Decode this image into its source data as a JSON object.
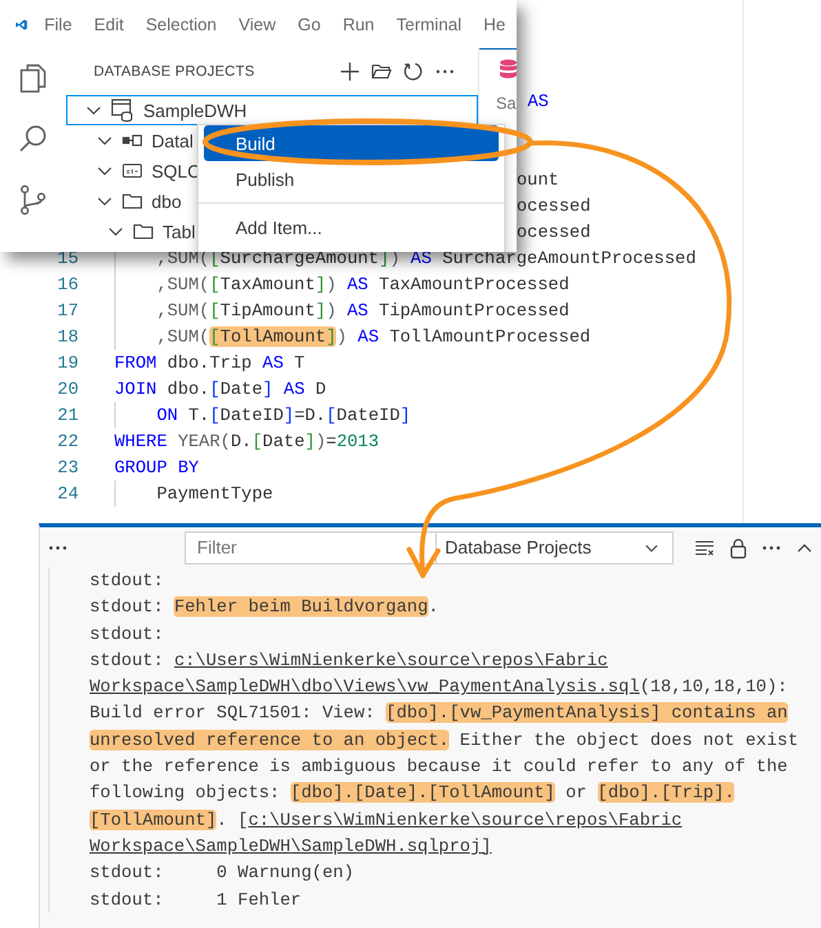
{
  "popup": {
    "menubar": [
      "File",
      "Edit",
      "Selection",
      "View",
      "Go",
      "Run",
      "Terminal",
      "He"
    ],
    "sidebar": {
      "title": "DATABASE PROJECTS",
      "tree": [
        {
          "label": "SampleDWH",
          "kind": "project",
          "expanded": true,
          "focused": true,
          "children": [
            {
              "label": "Datal",
              "kind": "datasource",
              "expanded": true,
              "focused": false
            },
            {
              "label": "SQLC",
              "kind": "variables",
              "expanded": true,
              "focused": false
            },
            {
              "label": "dbo",
              "kind": "folder",
              "expanded": true,
              "focused": false,
              "children": [
                {
                  "label": "Tabl",
                  "kind": "folder",
                  "expanded": true,
                  "focused": false
                }
              ]
            }
          ]
        }
      ]
    },
    "editor_peek": {
      "breadcrumb": "Sa"
    },
    "context_menu": [
      {
        "label": "Build",
        "selected": true,
        "separated": false
      },
      {
        "label": "Publish",
        "selected": false,
        "separated": false
      },
      {
        "label": "Add Item...",
        "selected": false,
        "separated": true
      }
    ]
  },
  "editor": {
    "fragments": [
      {
        "tokens": [
          {
            "text": "AS",
            "kind": "keyword"
          }
        ]
      },
      {
        "tokens": [
          {
            "text": "ount",
            "kind": "plain"
          }
        ]
      },
      {
        "tokens": [
          {
            "text": "ocessed",
            "kind": "plain"
          }
        ]
      },
      {
        "tokens": [
          {
            "text": "ocessed",
            "kind": "plain"
          }
        ]
      }
    ],
    "lines": [
      {
        "number": "15",
        "indented": true,
        "tokens": [
          {
            "text": ",SUM(",
            "kind": "func"
          },
          {
            "text": "[",
            "kind": "bracket2"
          },
          {
            "text": "SurchargeAmount",
            "kind": "plain"
          },
          {
            "text": "]",
            "kind": "bracket2"
          },
          {
            "text": ")",
            "kind": "func"
          },
          {
            "text": " AS ",
            "kind": "keyword"
          },
          {
            "text": "SurchargeAmountProcessed",
            "kind": "plain"
          }
        ]
      },
      {
        "number": "16",
        "indented": true,
        "tokens": [
          {
            "text": ",SUM(",
            "kind": "func"
          },
          {
            "text": "[",
            "kind": "bracket2"
          },
          {
            "text": "TaxAmount",
            "kind": "plain"
          },
          {
            "text": "]",
            "kind": "bracket2"
          },
          {
            "text": ")",
            "kind": "func"
          },
          {
            "text": " AS ",
            "kind": "keyword"
          },
          {
            "text": "TaxAmountProcessed",
            "kind": "plain"
          }
        ]
      },
      {
        "number": "17",
        "indented": true,
        "tokens": [
          {
            "text": ",SUM(",
            "kind": "func"
          },
          {
            "text": "[",
            "kind": "bracket2"
          },
          {
            "text": "TipAmount",
            "kind": "plain"
          },
          {
            "text": "]",
            "kind": "bracket2"
          },
          {
            "text": ")",
            "kind": "func"
          },
          {
            "text": " AS ",
            "kind": "keyword"
          },
          {
            "text": "TipAmountProcessed",
            "kind": "plain"
          }
        ]
      },
      {
        "number": "18",
        "indented": true,
        "tokens": [
          {
            "text": ",SUM(",
            "kind": "func"
          },
          {
            "kind": "highlight",
            "tokens": [
              {
                "text": "[",
                "kind": "bracket2"
              },
              {
                "text": "TollAmount",
                "kind": "plain"
              },
              {
                "text": "]",
                "kind": "bracket2"
              }
            ]
          },
          {
            "text": ")",
            "kind": "func"
          },
          {
            "text": " AS ",
            "kind": "keyword"
          },
          {
            "text": "TollAmountProcessed",
            "kind": "plain"
          }
        ]
      },
      {
        "number": "19",
        "indented": false,
        "tokens": [
          {
            "text": "FROM",
            "kind": "keyword"
          },
          {
            "text": " dbo.Trip ",
            "kind": "plain"
          },
          {
            "text": "AS",
            "kind": "keyword"
          },
          {
            "text": " T",
            "kind": "plain"
          }
        ]
      },
      {
        "number": "20",
        "indented": false,
        "tokens": [
          {
            "text": "JOIN",
            "kind": "keyword"
          },
          {
            "text": " dbo.",
            "kind": "plain"
          },
          {
            "text": "[",
            "kind": "bracket1"
          },
          {
            "text": "Date",
            "kind": "plain"
          },
          {
            "text": "]",
            "kind": "bracket1"
          },
          {
            "text": " AS ",
            "kind": "keyword"
          },
          {
            "text": "D",
            "kind": "plain"
          }
        ]
      },
      {
        "number": "21",
        "indented": true,
        "tokens": [
          {
            "text": "ON",
            "kind": "keyword"
          },
          {
            "text": " T.",
            "kind": "plain"
          },
          {
            "text": "[",
            "kind": "bracket1"
          },
          {
            "text": "DateID",
            "kind": "plain"
          },
          {
            "text": "]",
            "kind": "bracket1"
          },
          {
            "text": "=D.",
            "kind": "plain"
          },
          {
            "text": "[",
            "kind": "bracket1"
          },
          {
            "text": "DateID",
            "kind": "plain"
          },
          {
            "text": "]",
            "kind": "bracket1"
          }
        ]
      },
      {
        "number": "22",
        "indented": false,
        "tokens": [
          {
            "text": "WHERE ",
            "kind": "keyword"
          },
          {
            "text": "YEAR(",
            "kind": "func"
          },
          {
            "text": "D.",
            "kind": "plain"
          },
          {
            "text": "[",
            "kind": "bracket2"
          },
          {
            "text": "Date",
            "kind": "plain"
          },
          {
            "text": "]",
            "kind": "bracket2"
          },
          {
            "text": ")",
            "kind": "func"
          },
          {
            "text": "=",
            "kind": "plain"
          },
          {
            "text": "2013",
            "kind": "number"
          }
        ]
      },
      {
        "number": "23",
        "indented": false,
        "tokens": [
          {
            "text": "GROUP BY",
            "kind": "keyword"
          }
        ]
      },
      {
        "number": "24",
        "indented": true,
        "tokens": [
          {
            "text": "PaymentType",
            "kind": "plain"
          }
        ]
      }
    ]
  },
  "output_panel": {
    "filter": {
      "placeholder": "Filter"
    },
    "channel": "Database Projects",
    "lines": [
      {
        "segments": [
          {
            "text": "stdout:",
            "kind": "plain"
          }
        ]
      },
      {
        "segments": [
          {
            "text": "stdout: ",
            "kind": "plain"
          },
          {
            "text": "Fehler beim Buildvorgang",
            "kind": "highlight"
          },
          {
            "text": ".",
            "kind": "plain"
          }
        ]
      },
      {
        "segments": [
          {
            "text": "stdout:",
            "kind": "plain"
          }
        ]
      },
      {
        "segments": [
          {
            "text": "stdout: ",
            "kind": "plain"
          },
          {
            "text": "c:\\Users\\WimNienkerke\\source\\repos\\Fabric",
            "kind": "link"
          }
        ]
      },
      {
        "segments": [
          {
            "text": "Workspace\\SampleDWH\\dbo\\Views\\vw_PaymentAnalysis.sql",
            "kind": "link"
          },
          {
            "text": "(18,10,18,10):",
            "kind": "plain"
          }
        ]
      },
      {
        "segments": [
          {
            "text": "Build error SQL71501: View: ",
            "kind": "plain"
          },
          {
            "text": "[dbo].[vw_PaymentAnalysis] contains an",
            "kind": "highlight"
          }
        ]
      },
      {
        "segments": [
          {
            "text": "unresolved reference to an object.",
            "kind": "highlight"
          },
          {
            "text": " Either the object does not exist",
            "kind": "plain"
          }
        ]
      },
      {
        "segments": [
          {
            "text": "or the reference is ambiguous because it could refer to any of the",
            "kind": "plain"
          }
        ]
      },
      {
        "segments": [
          {
            "text": "following objects: ",
            "kind": "plain"
          },
          {
            "text": "[dbo].[Date].[TollAmount]",
            "kind": "highlight"
          },
          {
            "text": " or ",
            "kind": "plain"
          },
          {
            "text": "[dbo].[Trip].",
            "kind": "highlight"
          }
        ]
      },
      {
        "segments": [
          {
            "text": "[TollAmount]",
            "kind": "highlight"
          },
          {
            "text": ". [",
            "kind": "plain"
          },
          {
            "text": "c:\\Users\\WimNienkerke\\source\\repos\\Fabric",
            "kind": "link"
          }
        ]
      },
      {
        "segments": [
          {
            "text": "Workspace\\SampleDWH\\SampleDWH.sqlproj]",
            "kind": "link"
          }
        ]
      },
      {
        "segments": [
          {
            "text": "stdout:     0 Warnung(en)",
            "kind": "plain"
          }
        ]
      },
      {
        "segments": [
          {
            "text": "stdout:     1 Fehler",
            "kind": "plain"
          }
        ]
      }
    ]
  }
}
